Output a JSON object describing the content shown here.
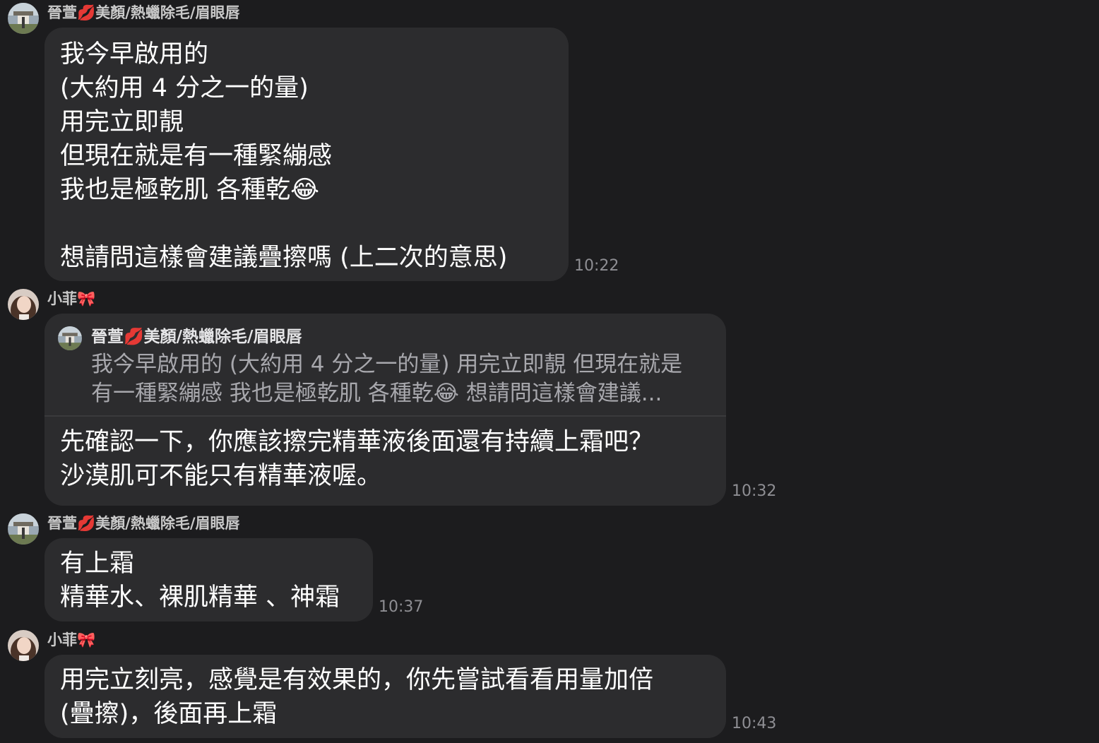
{
  "colors": {
    "background": "#1c1c1e",
    "bubble": "#2c2c2e",
    "timestamp": "#8e8e93",
    "quote_text": "#a8a8ad"
  },
  "messages": [
    {
      "sender": "晉萱💋美顏/熱蠟除毛/眉眼唇",
      "avatar_icon": "landscape-avatar-icon",
      "lines": [
        "我今早啟用的",
        "(大約用 4 分之一的量)",
        "用完立即靚",
        "但現在就是有一種緊繃感",
        "我也是極乾肌 各種乾😂",
        "",
        "想請問這樣會建議疊擦嗎 (上二次的意思)"
      ],
      "time": "10:22"
    },
    {
      "sender": "小菲🎀",
      "avatar_icon": "woman-portrait-avatar-icon",
      "reply_to": {
        "sender": "晉萱💋美顏/熱蠟除毛/眉眼唇",
        "lines": [
          "我今早啟用的 (大約用 4 分之一的量) 用完立即靚 但現在就是",
          "有一種緊繃感 我也是極乾肌 各種乾😂 想請問這樣會建議..."
        ]
      },
      "lines": [
        "先確認一下，你應該擦完精華液後面還有持續上霜吧？",
        "沙漠肌可不能只有精華液喔。"
      ],
      "time": "10:32"
    },
    {
      "sender": "晉萱💋美顏/熱蠟除毛/眉眼唇",
      "avatar_icon": "landscape-avatar-icon",
      "lines": [
        "有上霜",
        "精華水、裸肌精華 、神霜"
      ],
      "time": "10:37"
    },
    {
      "sender": "小菲🎀",
      "avatar_icon": "woman-portrait-avatar-icon",
      "lines": [
        "用完立刻亮，感覺是有效果的，你先嘗試看看用量加倍",
        "(疊擦)，後面再上霜"
      ],
      "time": "10:43"
    }
  ]
}
